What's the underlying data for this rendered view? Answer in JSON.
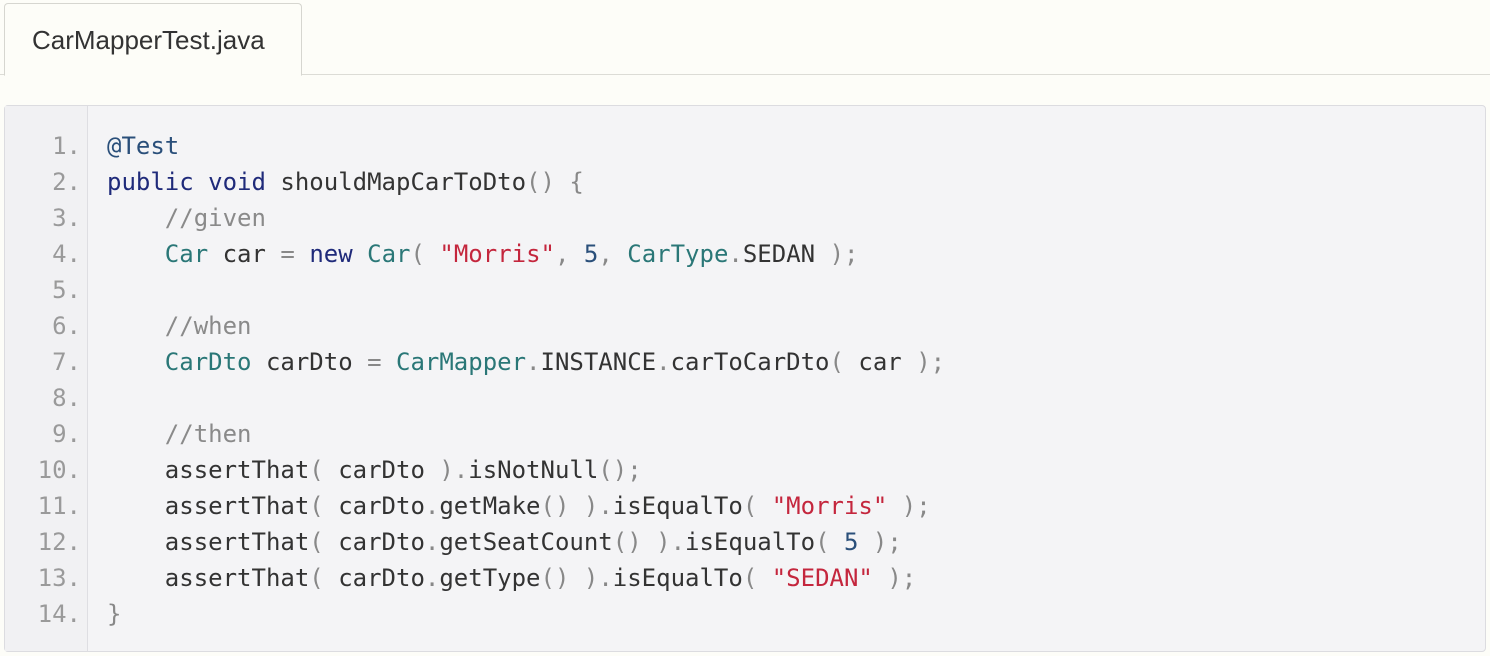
{
  "tab": {
    "label": "CarMapperTest.java"
  },
  "colors": {
    "keyword": "#1f2a7a",
    "annotation": "#2a4f7a",
    "type": "#2a7777",
    "string": "#c4263d",
    "number": "#2a4f7a",
    "comment": "#8a8a8a",
    "punctuation": "#888888",
    "text": "#333333"
  },
  "code": {
    "lines": [
      {
        "num": "1.",
        "tokens": [
          {
            "t": "@Test",
            "c": "ann"
          }
        ]
      },
      {
        "num": "2.",
        "tokens": [
          {
            "t": "public",
            "c": "kw"
          },
          {
            "t": " ",
            "c": "plain"
          },
          {
            "t": "void",
            "c": "kw"
          },
          {
            "t": " shouldMapCarToDto",
            "c": "plain"
          },
          {
            "t": "()",
            "c": "punc"
          },
          {
            "t": " ",
            "c": "plain"
          },
          {
            "t": "{",
            "c": "punc"
          }
        ]
      },
      {
        "num": "3.",
        "tokens": [
          {
            "t": "    //given",
            "c": "com"
          }
        ]
      },
      {
        "num": "4.",
        "tokens": [
          {
            "t": "    ",
            "c": "plain"
          },
          {
            "t": "Car",
            "c": "type"
          },
          {
            "t": " car ",
            "c": "plain"
          },
          {
            "t": "=",
            "c": "punc"
          },
          {
            "t": " ",
            "c": "plain"
          },
          {
            "t": "new",
            "c": "kw"
          },
          {
            "t": " ",
            "c": "plain"
          },
          {
            "t": "Car",
            "c": "type"
          },
          {
            "t": "(",
            "c": "punc"
          },
          {
            "t": " ",
            "c": "plain"
          },
          {
            "t": "\"Morris\"",
            "c": "str"
          },
          {
            "t": ",",
            "c": "punc"
          },
          {
            "t": " ",
            "c": "plain"
          },
          {
            "t": "5",
            "c": "num"
          },
          {
            "t": ",",
            "c": "punc"
          },
          {
            "t": " ",
            "c": "plain"
          },
          {
            "t": "CarType",
            "c": "type"
          },
          {
            "t": ".",
            "c": "punc"
          },
          {
            "t": "SEDAN ",
            "c": "plain"
          },
          {
            "t": ");",
            "c": "punc"
          }
        ]
      },
      {
        "num": "5.",
        "tokens": []
      },
      {
        "num": "6.",
        "tokens": [
          {
            "t": "    //when",
            "c": "com"
          }
        ]
      },
      {
        "num": "7.",
        "tokens": [
          {
            "t": "    ",
            "c": "plain"
          },
          {
            "t": "CarDto",
            "c": "type"
          },
          {
            "t": " carDto ",
            "c": "plain"
          },
          {
            "t": "=",
            "c": "punc"
          },
          {
            "t": " ",
            "c": "plain"
          },
          {
            "t": "CarMapper",
            "c": "type"
          },
          {
            "t": ".",
            "c": "punc"
          },
          {
            "t": "INSTANCE",
            "c": "plain"
          },
          {
            "t": ".",
            "c": "punc"
          },
          {
            "t": "carToCarDto",
            "c": "plain"
          },
          {
            "t": "(",
            "c": "punc"
          },
          {
            "t": " car ",
            "c": "plain"
          },
          {
            "t": ");",
            "c": "punc"
          }
        ]
      },
      {
        "num": "8.",
        "tokens": []
      },
      {
        "num": "9.",
        "tokens": [
          {
            "t": "    //then",
            "c": "com"
          }
        ]
      },
      {
        "num": "10.",
        "tokens": [
          {
            "t": "    assertThat",
            "c": "plain"
          },
          {
            "t": "(",
            "c": "punc"
          },
          {
            "t": " carDto ",
            "c": "plain"
          },
          {
            "t": ")",
            "c": "punc"
          },
          {
            "t": ".",
            "c": "punc"
          },
          {
            "t": "isNotNull",
            "c": "plain"
          },
          {
            "t": "();",
            "c": "punc"
          }
        ]
      },
      {
        "num": "11.",
        "tokens": [
          {
            "t": "    assertThat",
            "c": "plain"
          },
          {
            "t": "(",
            "c": "punc"
          },
          {
            "t": " carDto",
            "c": "plain"
          },
          {
            "t": ".",
            "c": "punc"
          },
          {
            "t": "getMake",
            "c": "plain"
          },
          {
            "t": "()",
            "c": "punc"
          },
          {
            "t": " ",
            "c": "plain"
          },
          {
            "t": ")",
            "c": "punc"
          },
          {
            "t": ".",
            "c": "punc"
          },
          {
            "t": "isEqualTo",
            "c": "plain"
          },
          {
            "t": "(",
            "c": "punc"
          },
          {
            "t": " ",
            "c": "plain"
          },
          {
            "t": "\"Morris\"",
            "c": "str"
          },
          {
            "t": " ",
            "c": "plain"
          },
          {
            "t": ");",
            "c": "punc"
          }
        ]
      },
      {
        "num": "12.",
        "tokens": [
          {
            "t": "    assertThat",
            "c": "plain"
          },
          {
            "t": "(",
            "c": "punc"
          },
          {
            "t": " carDto",
            "c": "plain"
          },
          {
            "t": ".",
            "c": "punc"
          },
          {
            "t": "getSeatCount",
            "c": "plain"
          },
          {
            "t": "()",
            "c": "punc"
          },
          {
            "t": " ",
            "c": "plain"
          },
          {
            "t": ")",
            "c": "punc"
          },
          {
            "t": ".",
            "c": "punc"
          },
          {
            "t": "isEqualTo",
            "c": "plain"
          },
          {
            "t": "(",
            "c": "punc"
          },
          {
            "t": " ",
            "c": "plain"
          },
          {
            "t": "5",
            "c": "num"
          },
          {
            "t": " ",
            "c": "plain"
          },
          {
            "t": ");",
            "c": "punc"
          }
        ]
      },
      {
        "num": "13.",
        "tokens": [
          {
            "t": "    assertThat",
            "c": "plain"
          },
          {
            "t": "(",
            "c": "punc"
          },
          {
            "t": " carDto",
            "c": "plain"
          },
          {
            "t": ".",
            "c": "punc"
          },
          {
            "t": "getType",
            "c": "plain"
          },
          {
            "t": "()",
            "c": "punc"
          },
          {
            "t": " ",
            "c": "plain"
          },
          {
            "t": ")",
            "c": "punc"
          },
          {
            "t": ".",
            "c": "punc"
          },
          {
            "t": "isEqualTo",
            "c": "plain"
          },
          {
            "t": "(",
            "c": "punc"
          },
          {
            "t": " ",
            "c": "plain"
          },
          {
            "t": "\"SEDAN\"",
            "c": "str"
          },
          {
            "t": " ",
            "c": "plain"
          },
          {
            "t": ");",
            "c": "punc"
          }
        ]
      },
      {
        "num": "14.",
        "tokens": [
          {
            "t": "}",
            "c": "punc"
          }
        ]
      }
    ]
  }
}
